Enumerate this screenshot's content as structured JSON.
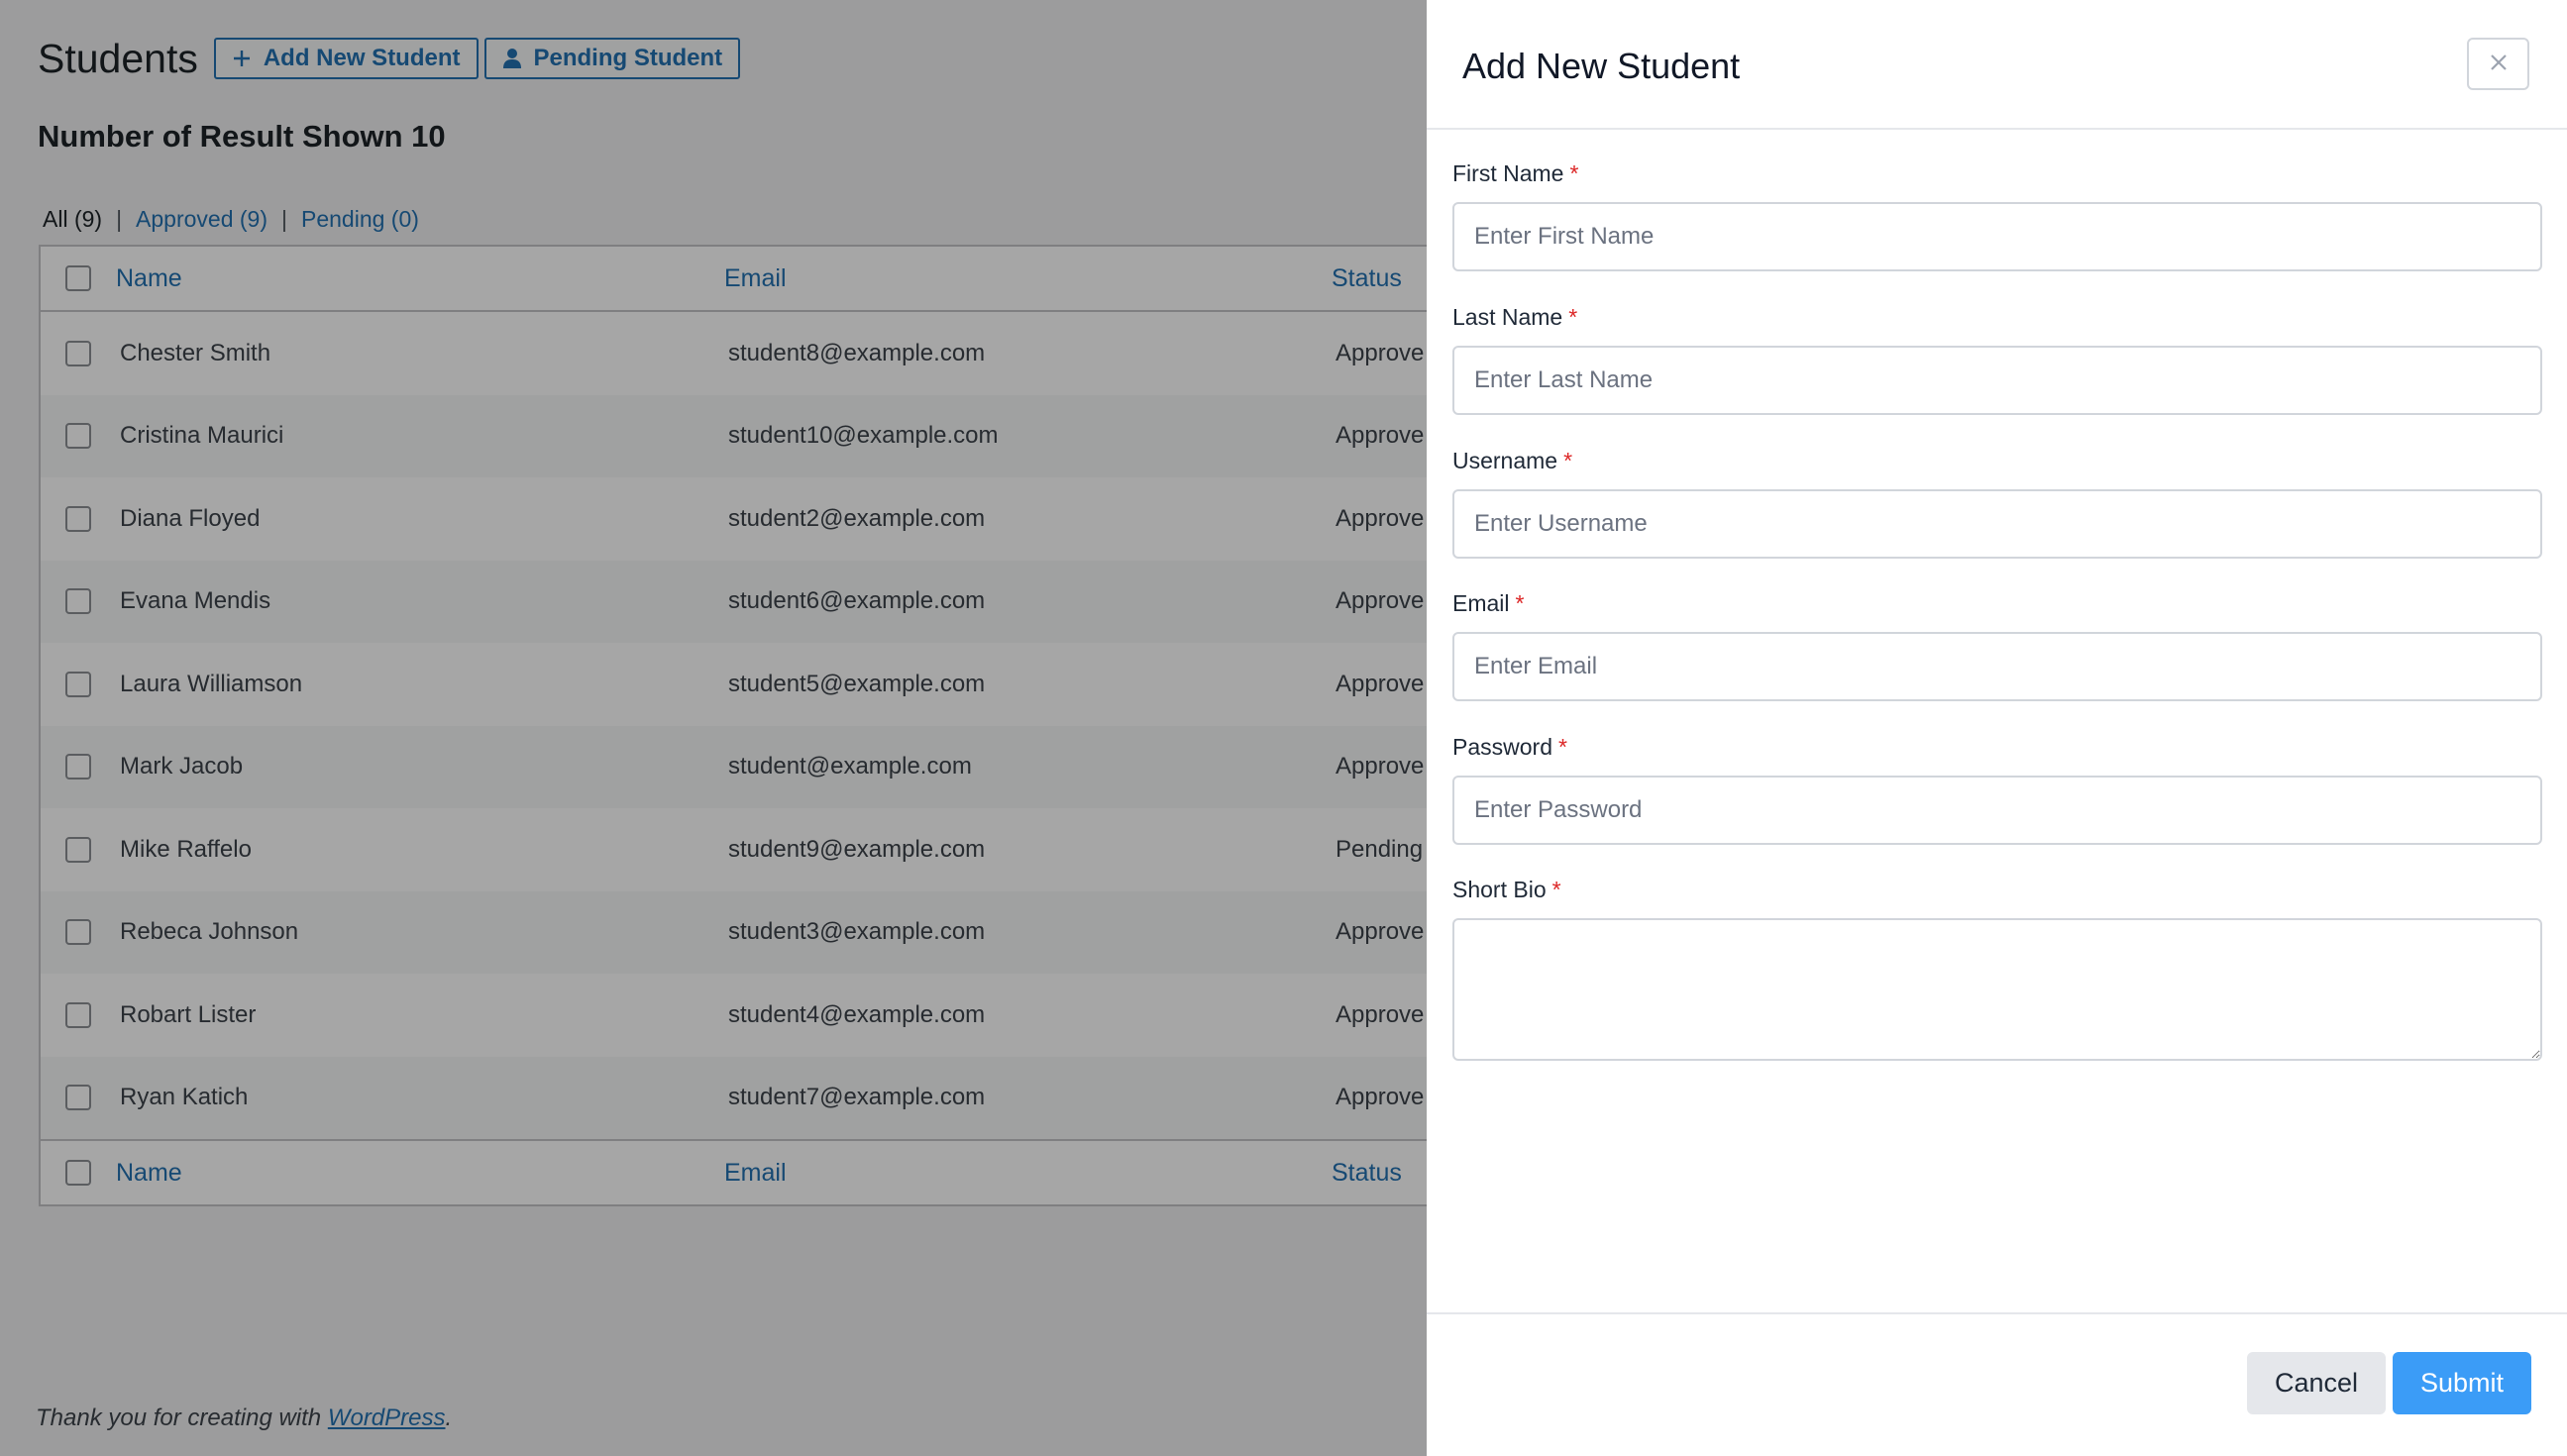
{
  "page": {
    "title": "Students",
    "add_button": "Add New Student",
    "pending_button": "Pending Student",
    "result_count": "Number of Result Shown 10",
    "filters": {
      "all": "All (9)",
      "approved": "Approved (9)",
      "pending": "Pending (0)",
      "separator": "|"
    },
    "table": {
      "columns": [
        "Name",
        "Email",
        "Status"
      ],
      "rows": [
        {
          "name": "Chester Smith",
          "email": "student8@example.com",
          "status": "Approve"
        },
        {
          "name": "Cristina Maurici",
          "email": "student10@example.com",
          "status": "Approve"
        },
        {
          "name": "Diana Floyed",
          "email": "student2@example.com",
          "status": "Approve"
        },
        {
          "name": "Evana Mendis",
          "email": "student6@example.com",
          "status": "Approve"
        },
        {
          "name": "Laura Williamson",
          "email": "student5@example.com",
          "status": "Approve"
        },
        {
          "name": "Mark Jacob",
          "email": "student@example.com",
          "status": "Approve"
        },
        {
          "name": "Mike Raffelo",
          "email": "student9@example.com",
          "status": "Pending"
        },
        {
          "name": "Rebeca Johnson",
          "email": "student3@example.com",
          "status": "Approve"
        },
        {
          "name": "Robart Lister",
          "email": "student4@example.com",
          "status": "Approve"
        },
        {
          "name": "Ryan Katich",
          "email": "student7@example.com",
          "status": "Approve"
        }
      ]
    },
    "footer": {
      "prefix": "Thank you for creating with ",
      "link": "WordPress",
      "suffix": "."
    }
  },
  "drawer": {
    "title": "Add New Student",
    "required_mark": "*",
    "fields": {
      "first_name": {
        "label": "First Name",
        "placeholder": "Enter First Name",
        "value": ""
      },
      "last_name": {
        "label": "Last Name",
        "placeholder": "Enter Last Name",
        "value": ""
      },
      "username": {
        "label": "Username",
        "placeholder": "Enter Username",
        "value": ""
      },
      "email": {
        "label": "Email",
        "placeholder": "Enter Email",
        "value": ""
      },
      "password": {
        "label": "Password",
        "placeholder": "Enter Password",
        "value": ""
      },
      "short_bio": {
        "label": "Short Bio",
        "value": ""
      }
    },
    "cancel": "Cancel",
    "submit": "Submit"
  },
  "icons": {
    "add": "plus-icon",
    "pending": "user-icon",
    "close": "close-icon"
  },
  "colors": {
    "link": "#2271b1",
    "submit": "#3b9cf7",
    "required": "#dc2626",
    "overlay": "rgba(0,0,0,0.35)"
  }
}
